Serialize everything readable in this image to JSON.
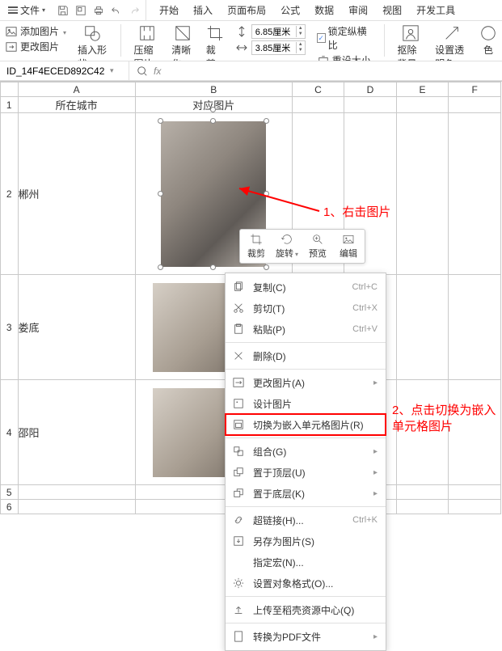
{
  "app": {
    "file_menu": "文件",
    "tabs": [
      "开始",
      "插入",
      "页面布局",
      "公式",
      "数据",
      "审阅",
      "视图",
      "开发工具"
    ]
  },
  "ribbon": {
    "add_image": "添加图片",
    "change_image": "更改图片",
    "insert_shape": "插入形状",
    "compress": "压缩图片",
    "clarity": "清晰化",
    "crop": "裁剪",
    "height": "6.85厘米",
    "width": "3.85厘米",
    "lock_ratio": "锁定纵横比",
    "reset_size": "重设大小",
    "remove_bg": "抠除背景",
    "set_transparent": "设置透明色",
    "color": "色"
  },
  "formula_bar": {
    "name": "ID_14F4ECED892C42",
    "fx": "fx"
  },
  "grid": {
    "columns": [
      "A",
      "B",
      "C",
      "D",
      "E",
      "F"
    ],
    "header_row": {
      "A": "所在城市",
      "B": "对应图片"
    },
    "rows": [
      {
        "num": "1"
      },
      {
        "num": "2",
        "A": "郴州"
      },
      {
        "num": "3",
        "A": "娄底"
      },
      {
        "num": "4",
        "A": "邵阳"
      },
      {
        "num": "5"
      },
      {
        "num": "6"
      }
    ]
  },
  "float_toolbar": {
    "crop": "裁剪",
    "rotate": "旋转",
    "preview": "预览",
    "edit": "编辑"
  },
  "context_menu": {
    "copy": {
      "label": "复制(C)",
      "shortcut": "Ctrl+C"
    },
    "cut": {
      "label": "剪切(T)",
      "shortcut": "Ctrl+X"
    },
    "paste": {
      "label": "粘贴(P)",
      "shortcut": "Ctrl+V"
    },
    "delete": {
      "label": "删除(D)"
    },
    "change_pic": {
      "label": "更改图片(A)"
    },
    "design_pic": {
      "label": "设计图片"
    },
    "to_cell_pic": {
      "label": "切换为嵌入单元格图片(R)"
    },
    "group": {
      "label": "组合(G)"
    },
    "to_front": {
      "label": "置于顶层(U)"
    },
    "to_back": {
      "label": "置于底层(K)"
    },
    "hyperlink": {
      "label": "超链接(H)...",
      "shortcut": "Ctrl+K"
    },
    "save_as_pic": {
      "label": "另存为图片(S)"
    },
    "assign_macro": {
      "label": "指定宏(N)..."
    },
    "format_obj": {
      "label": "设置对象格式(O)..."
    },
    "upload": {
      "label": "上传至稻壳资源中心(Q)"
    },
    "to_pdf": {
      "label": "转换为PDF文件"
    }
  },
  "annotations": {
    "a1": "1、右击图片",
    "a2_line1": "2、点击切换为嵌入",
    "a2_line2": "单元格图片"
  }
}
